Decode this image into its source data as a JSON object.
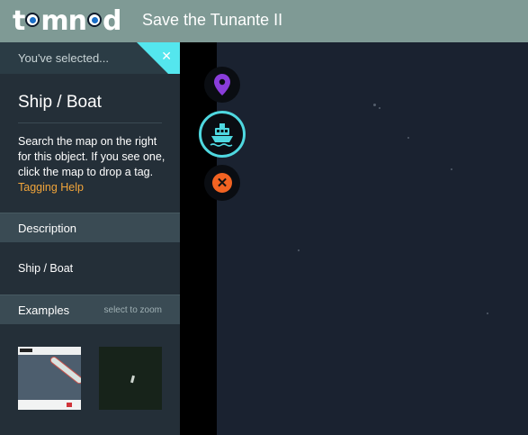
{
  "header": {
    "logo_text": "tomnod",
    "title": "Save the Tunante II"
  },
  "sidebar": {
    "selected_label": "You've selected...",
    "object_title": "Ship / Boat",
    "instructions": "Search the map on the right for this object. If you see one, click the map to drop a tag.",
    "help_link": "Tagging Help",
    "description_header": "Description",
    "description_text": "Ship / Boat",
    "examples_header": "Examples",
    "examples_hint": "select to zoom"
  },
  "tools": {
    "pin_icon": "location-pin-icon",
    "ship_icon": "ship-icon",
    "cancel_icon": "cancel-icon"
  },
  "colors": {
    "header_bg": "#7f9a95",
    "accent_cyan": "#54e6ee",
    "help_link": "#f0a43a",
    "pin_purple": "#8a3ddb",
    "cancel_orange": "#f26322"
  }
}
